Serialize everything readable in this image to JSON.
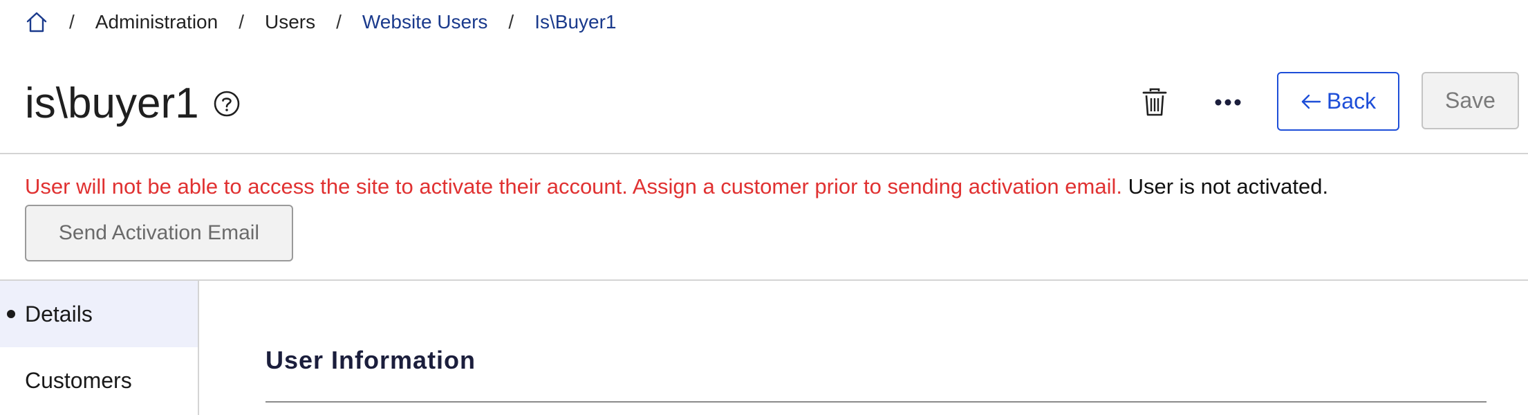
{
  "breadcrumb": {
    "home_icon": "home-icon",
    "separator": "/",
    "items": [
      {
        "label": "Administration"
      },
      {
        "label": "Users"
      },
      {
        "label": "Website Users"
      },
      {
        "label": "Is\\Buyer1"
      }
    ]
  },
  "header": {
    "title": "is\\buyer1",
    "help_icon": "help-circle-icon",
    "delete_icon": "trash-icon",
    "more_icon": "more-horizontal-icon",
    "back_label": "Back",
    "save_label": "Save"
  },
  "alert": {
    "error_text": "User will not be able to access the site to activate their account. Assign a customer prior to sending activation email.",
    "status_text": "User is not activated.",
    "activation_button": "Send Activation Email"
  },
  "sidebar": {
    "items": [
      {
        "label": "Details",
        "active": true
      },
      {
        "label": "Customers",
        "active": false
      }
    ]
  },
  "main": {
    "section_title": "User Information"
  },
  "colors": {
    "accent": "#1d4ed8",
    "error": "#e03131",
    "breadcrumb_link": "#1a3a8c",
    "active_nav_bg": "#eef0fb"
  }
}
